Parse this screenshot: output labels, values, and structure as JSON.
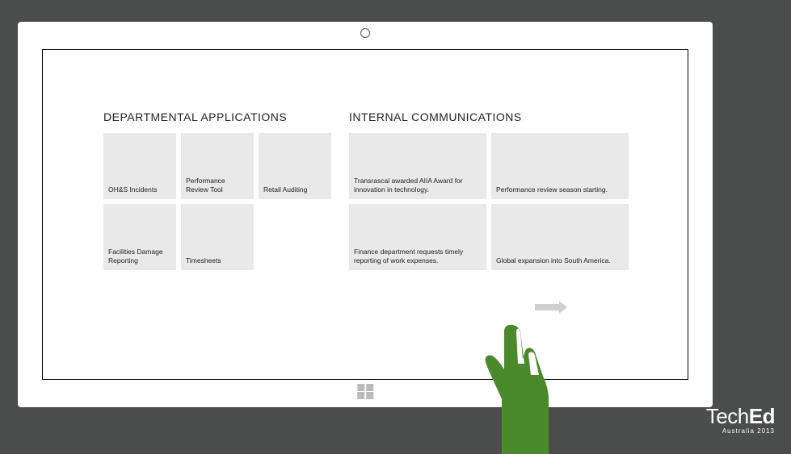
{
  "sections": {
    "departmental": {
      "title": "DEPARTMENTAL APPLICATIONS",
      "tiles": [
        {
          "label": "OH&S Incidents"
        },
        {
          "label": "Performance Review Tool"
        },
        {
          "label": "Retail Auditing"
        },
        {
          "label": "Facilities Damage Reporting"
        },
        {
          "label": "Timesheets"
        }
      ]
    },
    "communications": {
      "title": "INTERNAL COMMUNICATIONS",
      "tiles": [
        {
          "label": "Transrascal awarded AIIA Award for innovation in technology."
        },
        {
          "label": "Performance review season starting."
        },
        {
          "label": "Finance department requests timely reporting of work expenses."
        },
        {
          "label": "Global expansion into South America."
        }
      ]
    }
  },
  "branding": {
    "name_light": "Tech",
    "name_bold": "Ed",
    "subtitle": "Australia 2013"
  }
}
